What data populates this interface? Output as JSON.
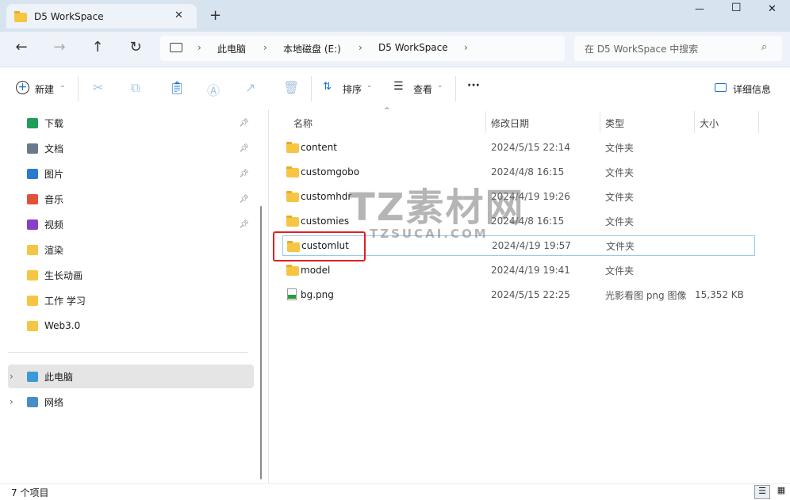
{
  "window": {
    "tab_title": "D5 WorkSpace",
    "new_tab": "+",
    "minimize": "—",
    "maximize": "☐",
    "close": "✕"
  },
  "nav": {
    "back": "←",
    "forward": "→",
    "up": "↑",
    "refresh": "↻",
    "breadcrumb": [
      "此电脑",
      "本地磁盘 (E:)",
      "D5 WorkSpace"
    ],
    "search_placeholder": "在 D5 WorkSpace 中搜索"
  },
  "toolbar": {
    "new": "新建",
    "sort": "排序",
    "view": "查看",
    "more": "···",
    "details": "详细信息"
  },
  "sidebar": {
    "quick": [
      {
        "label": "下载",
        "icon": "download-icon",
        "pinned": true
      },
      {
        "label": "文档",
        "icon": "document-icon",
        "pinned": true
      },
      {
        "label": "图片",
        "icon": "pictures-icon",
        "pinned": true
      },
      {
        "label": "音乐",
        "icon": "music-icon",
        "pinned": true
      },
      {
        "label": "视频",
        "icon": "video-icon",
        "pinned": true
      },
      {
        "label": "渲染",
        "icon": "folder-icon"
      },
      {
        "label": "生长动画",
        "icon": "folder-icon"
      },
      {
        "label": "工作 学习",
        "icon": "folder-icon"
      },
      {
        "label": "Web3.0",
        "icon": "folder-icon"
      }
    ],
    "this_pc": "此电脑",
    "network": "网络"
  },
  "columns": {
    "name": "名称",
    "date": "修改日期",
    "type": "类型",
    "size": "大小"
  },
  "files": [
    {
      "name": "content",
      "date": "2024/5/15 22:14",
      "type": "文件夹",
      "size": ""
    },
    {
      "name": "customgobo",
      "date": "2024/4/8 16:15",
      "type": "文件夹",
      "size": ""
    },
    {
      "name": "customhdr",
      "date": "2024/4/19 19:26",
      "type": "文件夹",
      "size": ""
    },
    {
      "name": "customies",
      "date": "2024/4/8 16:15",
      "type": "文件夹",
      "size": ""
    },
    {
      "name": "customlut",
      "date": "2024/4/19 19:57",
      "type": "文件夹",
      "size": "",
      "selected": true
    },
    {
      "name": "model",
      "date": "2024/4/19 19:41",
      "type": "文件夹",
      "size": ""
    },
    {
      "name": "bg.png",
      "date": "2024/5/15 22:25",
      "type": "光影看图 png 图像",
      "size": "15,352 KB"
    }
  ],
  "status": {
    "count": "7 个项目"
  },
  "watermark": {
    "main": "TZ素材网",
    "sub": "TZSUCAI.COM"
  },
  "colors": {
    "highlight": "#e02020",
    "selection_border": "#99c9ef"
  }
}
